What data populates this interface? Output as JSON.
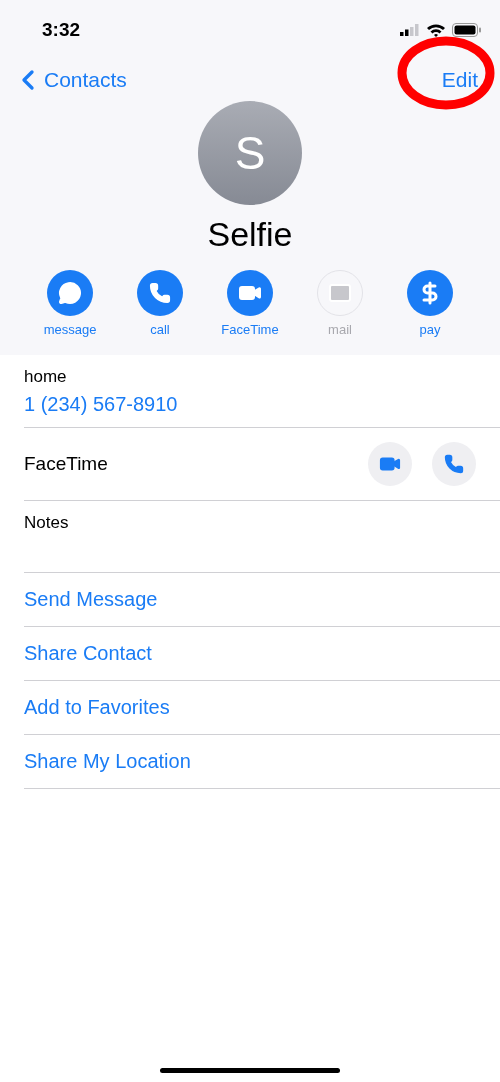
{
  "status_bar": {
    "time": "3:32"
  },
  "nav": {
    "back": "Contacts",
    "edit": "Edit",
    "edit_highlighted": true
  },
  "contact": {
    "initial": "S",
    "name": "Selfie"
  },
  "actions": [
    {
      "kind": "message",
      "label": "message",
      "disabled": false
    },
    {
      "kind": "call",
      "label": "call",
      "disabled": false
    },
    {
      "kind": "video",
      "label": "FaceTime",
      "disabled": false
    },
    {
      "kind": "mail",
      "label": "mail",
      "disabled": true
    },
    {
      "kind": "pay",
      "label": "pay",
      "disabled": false
    }
  ],
  "phone": {
    "label": "home",
    "number": "1 (234) 567-8910"
  },
  "facetime": {
    "label": "FaceTime"
  },
  "notes": {
    "label": "Notes"
  },
  "links": [
    "Send Message",
    "Share Contact",
    "Add to Favorites",
    "Share My Location"
  ]
}
